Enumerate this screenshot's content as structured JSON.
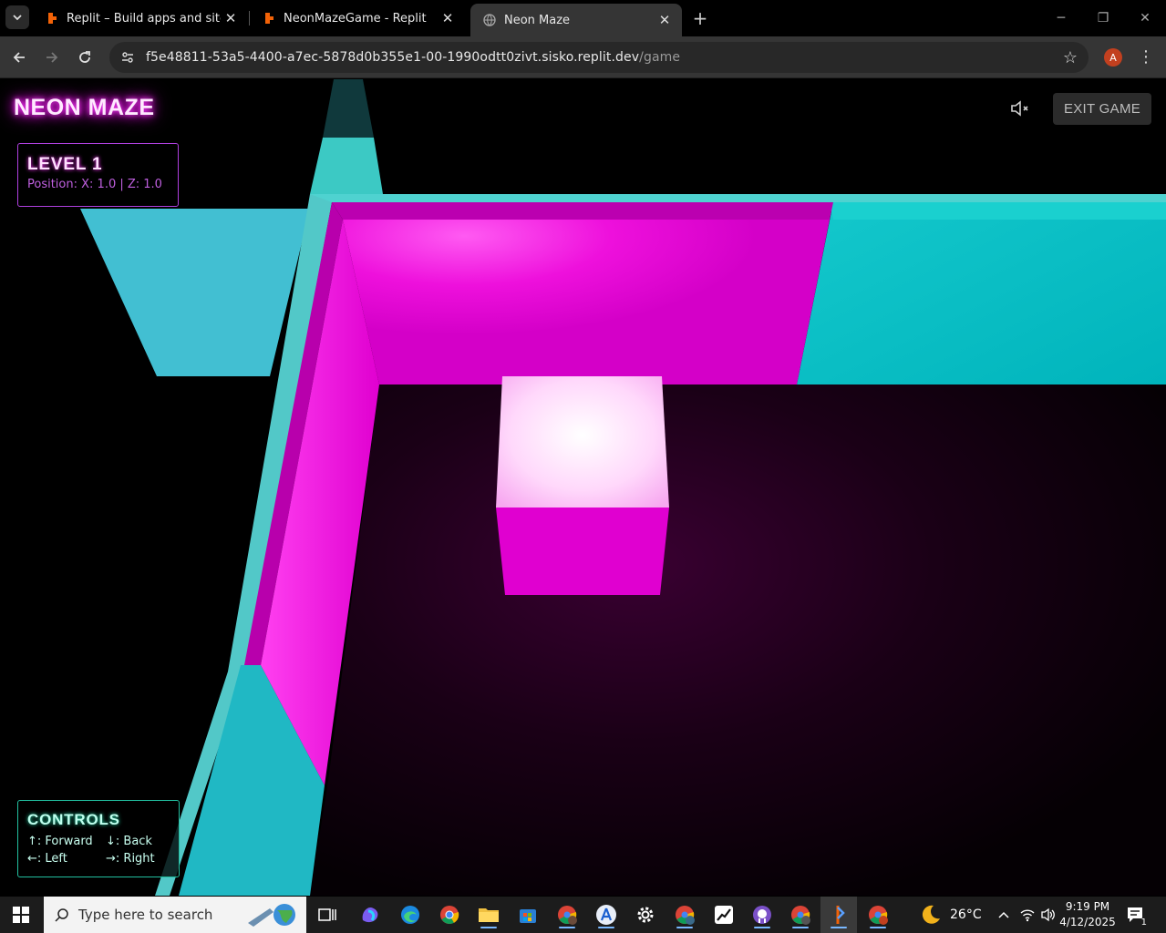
{
  "browser": {
    "tabs": [
      {
        "title": "Replit – Build apps and sites wit",
        "active": false,
        "icon": "replit-icon"
      },
      {
        "title": "NeonMazeGame - Replit",
        "active": false,
        "icon": "replit-icon"
      },
      {
        "title": "Neon Maze",
        "active": true,
        "icon": "globe-icon"
      }
    ],
    "url": "f5e48811-53a5-4400-a7ec-5878d0b355e1-00-1990odtt0zivt.sisko.replit.dev",
    "url_path": "/game",
    "profile_initial": "A"
  },
  "game": {
    "title": "NEON MAZE",
    "exit_label": "EXIT GAME",
    "mute_icon": "speaker-muted-icon",
    "level_label": "LEVEL 1",
    "position_text": "Position: X: 1.0 | Z: 1.0",
    "controls_title": "CONTROLS",
    "controls": [
      {
        "key": "↑: Forward"
      },
      {
        "key": "↓: Back"
      },
      {
        "key": "←: Left"
      },
      {
        "key": "→: Right"
      }
    ],
    "colors": {
      "wall_magenta": "#e000d0",
      "wall_cyan": "#00b8c0",
      "title_glow": "#ff00ff",
      "controls_glow": "#20e0b0"
    }
  },
  "taskbar": {
    "search_placeholder": "Type here to search",
    "temperature": "26°C",
    "time": "9:19 PM",
    "date": "4/12/2025",
    "notification_count": "1"
  }
}
